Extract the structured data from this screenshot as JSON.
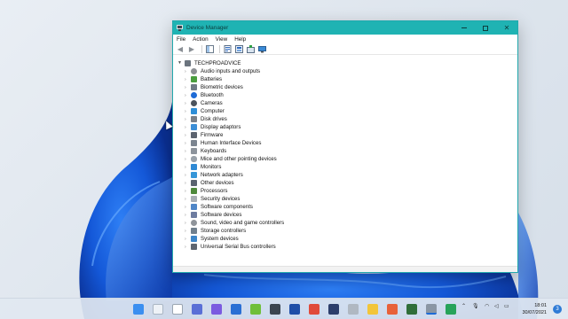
{
  "window": {
    "title": "Device Manager",
    "controls": {
      "minimize": "—",
      "maximize": "☐",
      "close": "✕"
    }
  },
  "menu": {
    "items": [
      "File",
      "Action",
      "View",
      "Help"
    ]
  },
  "tree": {
    "root": "TECHPROADVICE",
    "categories": [
      "Audio inputs and outputs",
      "Batteries",
      "Biometric devices",
      "Bluetooth",
      "Cameras",
      "Computer",
      "Disk drives",
      "Display adaptors",
      "Firmware",
      "Human Interface Devices",
      "Keyboards",
      "Mice and other pointing devices",
      "Monitors",
      "Network adapters",
      "Other devices",
      "Processors",
      "Security devices",
      "Software components",
      "Software devices",
      "Sound, video and game controllers",
      "Storage controllers",
      "System devices",
      "Universal Serial Bus controllers"
    ]
  },
  "taskbar": {
    "time": "18:01",
    "date": "30/07/2021",
    "notification_count": "3"
  },
  "colors": {
    "titlebar": "#1fb3b3",
    "accent": "#1e6bd6"
  }
}
